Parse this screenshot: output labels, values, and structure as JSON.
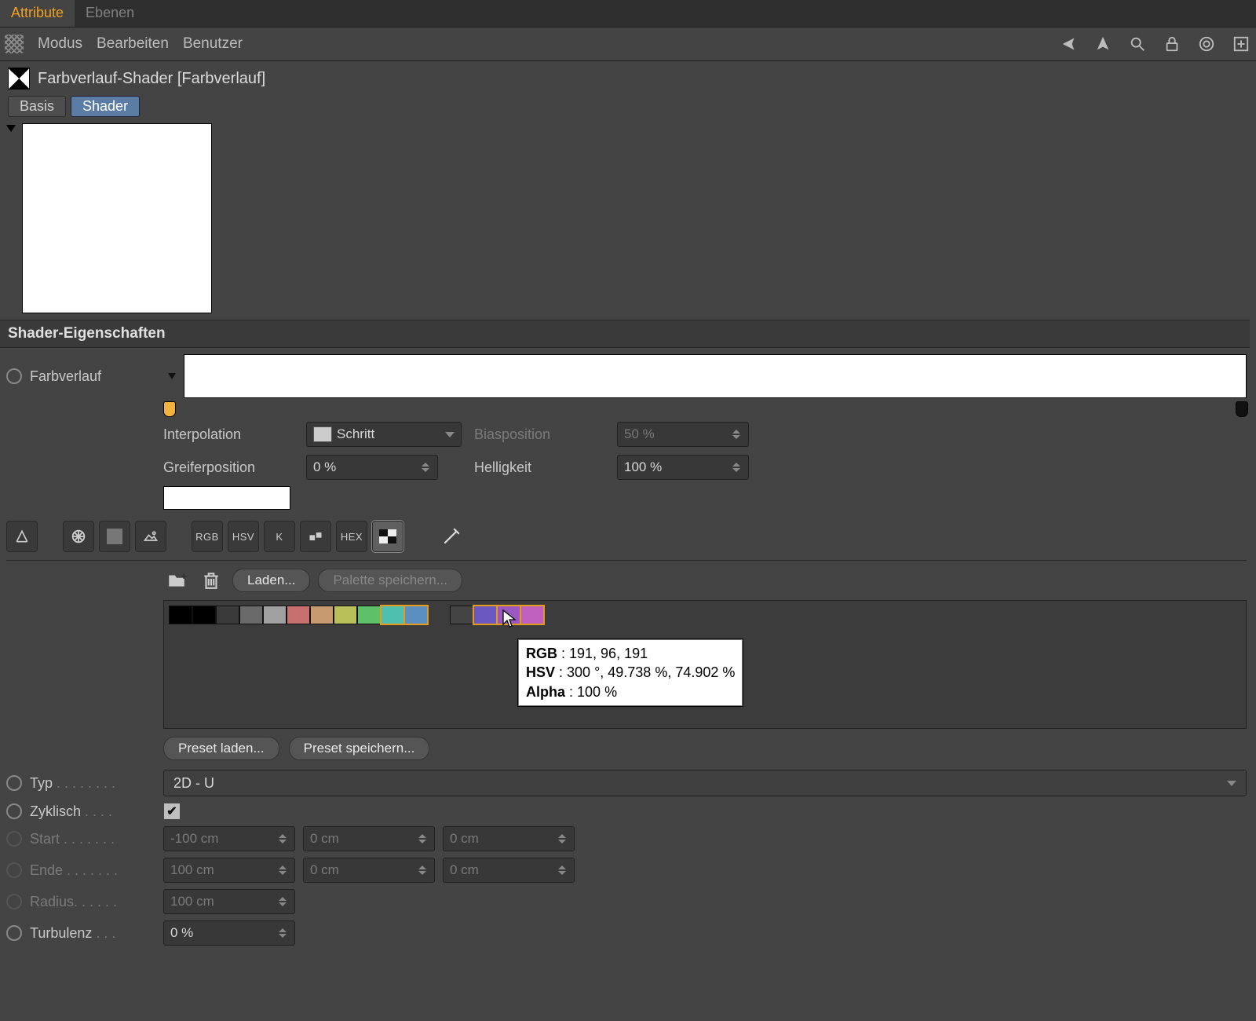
{
  "tabs": {
    "attribute": "Attribute",
    "ebenen": "Ebenen"
  },
  "menu": {
    "modus": "Modus",
    "bearbeiten": "Bearbeiten",
    "benutzer": "Benutzer"
  },
  "title": "Farbverlauf-Shader [Farbverlauf]",
  "innerTabs": {
    "basis": "Basis",
    "shader": "Shader"
  },
  "section": "Shader-Eigenschaften",
  "gradient_label": "Farbverlauf",
  "interpolation": {
    "label": "Interpolation",
    "value": "Schritt"
  },
  "greifer": {
    "label": "Greiferposition",
    "value": "0 %"
  },
  "bias": {
    "label": "Biasposition",
    "value": "50 %"
  },
  "helligkeit": {
    "label": "Helligkeit",
    "value": "100 %"
  },
  "modes": {
    "rgb": "RGB",
    "hsv": "HSV",
    "k": "K",
    "hex": "HEX"
  },
  "palette_buttons": {
    "laden": "Laden...",
    "speichern": "Palette speichern..."
  },
  "presets": {
    "load": "Preset laden...",
    "save": "Preset speichern..."
  },
  "swatches": [
    {
      "c": "#000000"
    },
    {
      "c": "#000000"
    },
    {
      "c": "#3a3a3a"
    },
    {
      "c": "#6a6a6a"
    },
    {
      "c": "#a0a0a0"
    },
    {
      "c": "#c87070"
    },
    {
      "c": "#c89a70"
    },
    {
      "c": "#b9c05a"
    },
    {
      "c": "#5fc06a"
    },
    {
      "c": "#4fbfb0",
      "sel": true
    },
    {
      "c": "#5a8fc0",
      "sel": true
    },
    {
      "c": "#444444"
    },
    {
      "c": "#6a58c0",
      "sel": true
    },
    {
      "c": "#9a58c0",
      "sel": true
    },
    {
      "c": "#bf60bf",
      "sel": true
    }
  ],
  "tooltip": {
    "rgb_label": "RGB",
    "rgb_value": "191, 96, 191",
    "hsv_label": "HSV",
    "hsv_value": "300 °, 49.738 %, 74.902 %",
    "alpha_label": "Alpha",
    "alpha_value": "100 %"
  },
  "typ": {
    "label": "Typ",
    "value": "2D - U"
  },
  "zyklisch": {
    "label": "Zyklisch"
  },
  "start": {
    "label": "Start",
    "x": "-100 cm",
    "y": "0 cm",
    "z": "0 cm"
  },
  "ende": {
    "label": "Ende",
    "x": "100 cm",
    "y": "0 cm",
    "z": "0 cm"
  },
  "radius": {
    "label": "Radius",
    "value": "100 cm"
  },
  "turbulenz": {
    "label": "Turbulenz",
    "value": "0 %"
  }
}
